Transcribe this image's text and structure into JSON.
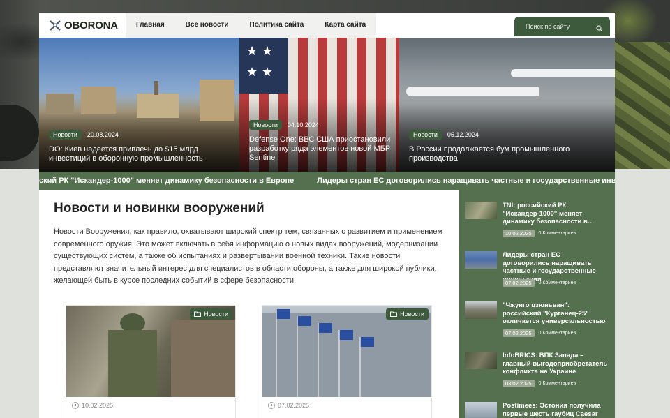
{
  "header": {
    "logo_text": "OBORONA",
    "nav": [
      "Главная",
      "Все новости",
      "Политика сайта",
      "Карта сайта"
    ],
    "search_placeholder": "Поиск по сайту"
  },
  "hero": [
    {
      "badge": "Новости",
      "date": "20.08.2024",
      "title": "DO: Киев надеется привлечь до $15 млрд инвестиций в оборонную промышленность"
    },
    {
      "badge": "Новости",
      "date": "04.10.2024",
      "title": "Defense One: ВВС США приостановили разработку ряда элементов новой МБР Sentine"
    },
    {
      "badge": "Новости",
      "date": "05.12.2024",
      "title": "В России продолжается бум промышленного производства"
    }
  ],
  "ticker": [
    "ский РК \"Искандер-1000\" меняет динамику безопасности в Европе",
    "Лидеры стран ЕС договорились наращивать частные и государственные инвести"
  ],
  "main": {
    "title": "Новости и новинки вооружений",
    "intro": "Новости Вооружения, как правило, охватывают широкий спектр тем, связанных с развитием и применением современного оружия. Это может включать в себя информацию о новых видах вооружений, модернизации существующих систем, а также об испытаниях и развертывании военной техники. Такие новости представляют значительный интерес для специалистов в области обороны, а также для широкой публики, желающей быть в курсе последних событий в сфере безопасности."
  },
  "cards": [
    {
      "badge": "Новости",
      "date": "10.02.2025"
    },
    {
      "badge": "Новости",
      "date": "07.02.2025"
    }
  ],
  "sidebar": [
    {
      "title": "TNI: российский РК \"Искандер-1000\" меняет динамику безопасности в…",
      "date": "10.02.2025",
      "comments": "0 Комментариев"
    },
    {
      "title": "Лидеры стран ЕС договорились наращивать частные и государственные инвестиции …",
      "date": "07.02.2025",
      "comments": "0 Комментариев"
    },
    {
      "title": "\"Чжунго цзюньван\": российский \"Курганец-25\" отличается универсальностью",
      "date": "07.02.2025",
      "comments": "0 Комментариев"
    },
    {
      "title": "InfoBRICS: ВПК Запада – главный выгодоприобретатель конфликта на Украине",
      "date": "03.02.2025",
      "comments": "0 Комментариев"
    },
    {
      "title": "Postimees: Эстония получила первые шесть гаубиц Caesar",
      "date": "",
      "comments": ""
    }
  ]
}
